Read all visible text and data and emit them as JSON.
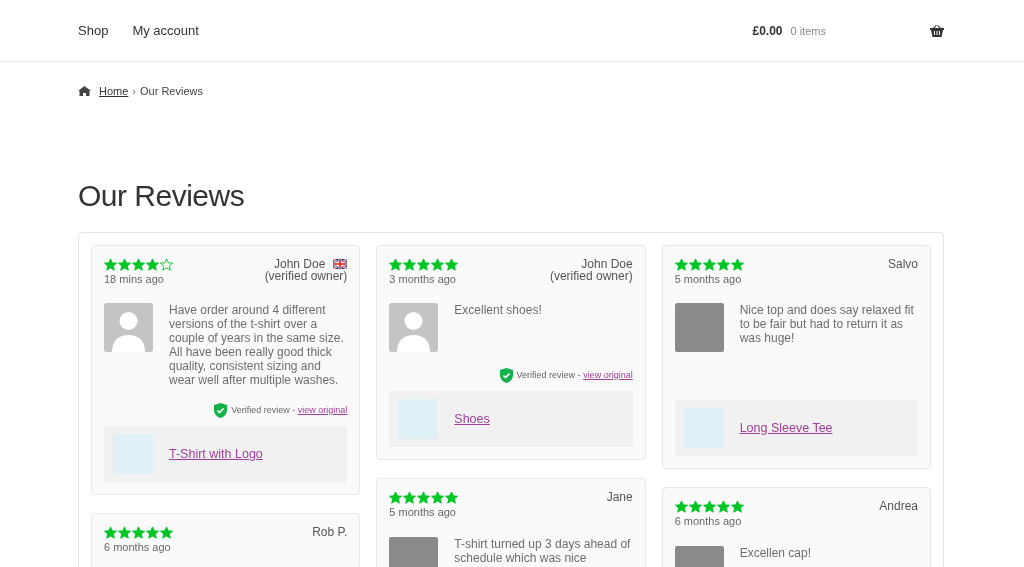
{
  "header": {
    "nav": [
      "Shop",
      "My account"
    ],
    "cart": {
      "total": "£0.00",
      "count": "0 items"
    }
  },
  "breadcrumb": {
    "home": "Home",
    "separator": "›",
    "current": "Our Reviews"
  },
  "title": "Our Reviews",
  "columns": [
    {
      "reviews": [
        {
          "stars": 4,
          "time": "18 mins ago",
          "author": "John Doe",
          "badge": "(verified owner)",
          "flag": true,
          "kind": "avatar",
          "text": "Have order around 4 different versions of the t-shirt over a couple of years in the same size. All have been really good thick quality, consistent sizing and wear well after multiple washes.",
          "verified": "Verified review - ",
          "link": "view original",
          "product": "T-Shirt with Logo"
        },
        {
          "stars": 5,
          "time": "6 months ago",
          "author": "Rob P.",
          "flag": false
        }
      ]
    },
    {
      "reviews": [
        {
          "stars": 5,
          "time": "3 months ago",
          "author": "John Doe",
          "badge": "(verified owner)",
          "flag": false,
          "kind": "avatar",
          "text": "Excellent shoes!",
          "verified": "Verified review - ",
          "link": "view original",
          "product": "Shoes"
        },
        {
          "stars": 5,
          "time": "5 months ago",
          "author": "Jane",
          "flag": false,
          "kind": "photo",
          "text": "T-shirt turned up 3 days ahead of schedule which was nice"
        }
      ]
    },
    {
      "reviews": [
        {
          "stars": 5,
          "time": "5 months ago",
          "author": "Salvo",
          "flag": false,
          "kind": "photo",
          "text": "Nice top and does say relaxed fit to be fair but had to return it as was huge!",
          "product": "Long Sleeve Tee"
        },
        {
          "stars": 5,
          "time": "6 months ago",
          "author": "Andrea",
          "flag": false,
          "kind": "photo",
          "text": "Excellen cap!"
        }
      ]
    }
  ]
}
